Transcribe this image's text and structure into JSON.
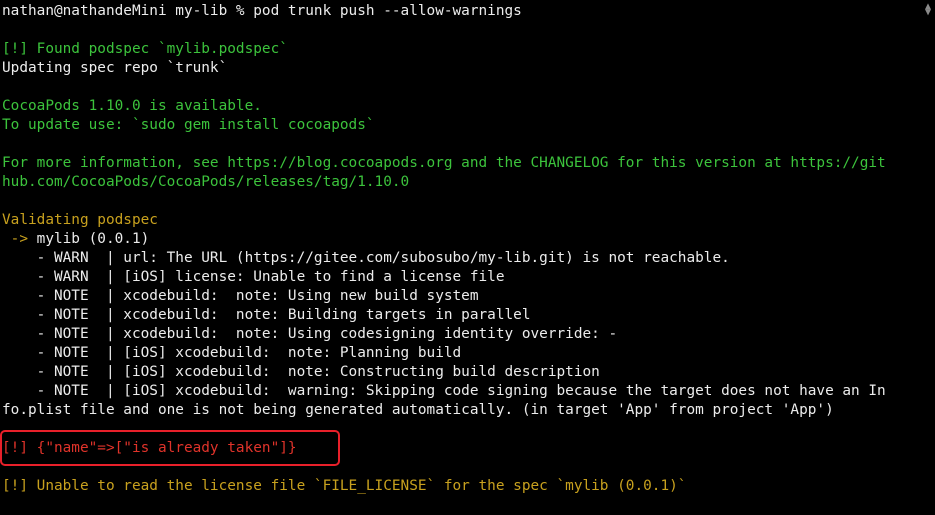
{
  "terminal": {
    "prompt_line": "nathan@nathandeMini my-lib % pod trunk push --allow-warnings",
    "found_podspec": "[!] Found podspec `mylib.podspec`",
    "updating_repo": "Updating spec repo `trunk`",
    "cocoapods_available": "CocoaPods 1.10.0 is available.",
    "update_instructions": "To update use: `sudo gem install cocoapods`",
    "more_info_line1": "For more information, see https://blog.cocoapods.org and the CHANGELOG for this version at https://git",
    "more_info_line2": "hub.com/CocoaPods/CocoaPods/releases/tag/1.10.0",
    "validating": "Validating podspec",
    "pod_arrow": " -> ",
    "pod_name": "mylib (0.0.1)",
    "messages": [
      "    - WARN  | url: The URL (https://gitee.com/subosubo/my-lib.git) is not reachable.",
      "    - WARN  | [iOS] license: Unable to find a license file",
      "    - NOTE  | xcodebuild:  note: Using new build system",
      "    - NOTE  | xcodebuild:  note: Building targets in parallel",
      "    - NOTE  | xcodebuild:  note: Using codesigning identity override: -",
      "    - NOTE  | [iOS] xcodebuild:  note: Planning build",
      "    - NOTE  | [iOS] xcodebuild:  note: Constructing build description",
      "    - NOTE  | [iOS] xcodebuild:  warning: Skipping code signing because the target does not have an In",
      "fo.plist file and one is not being generated automatically. (in target 'App' from project 'App')"
    ],
    "error_line": "[!] {\"name\"=>[\"is already taken\"]}",
    "license_warning": "[!] Unable to read the license file `FILE_LICENSE` for the spec `mylib (0.0.1)`"
  },
  "icons": {
    "scroll": "scroll-arrows-icon"
  },
  "colors": {
    "background": "#000000",
    "green": "#3cc33c",
    "orange": "#c8a11e",
    "red": "#e0332a",
    "highlight_border": "#e8202a",
    "text": "#ececec"
  }
}
